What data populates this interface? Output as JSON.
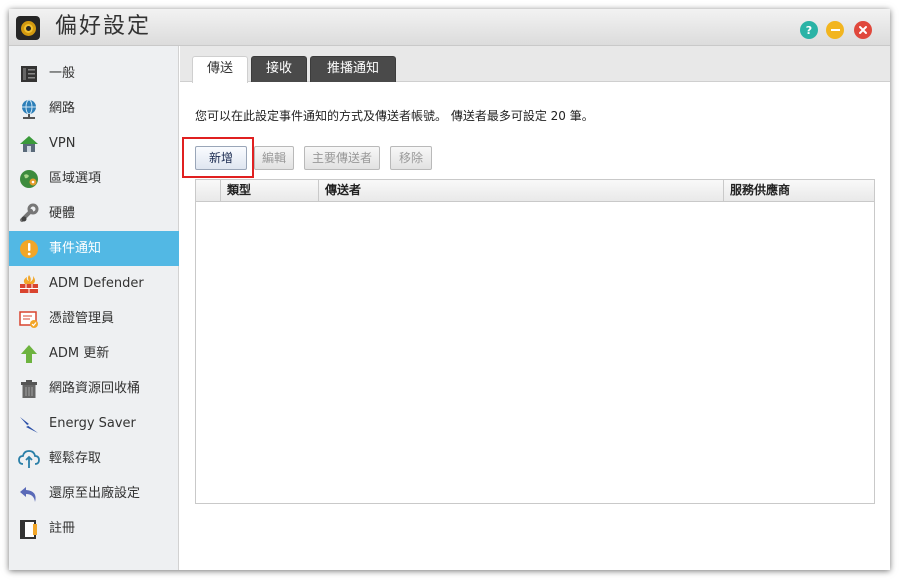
{
  "window": {
    "title": "偏好設定",
    "controls": {
      "help": "?"
    }
  },
  "sidebar": {
    "items": [
      {
        "label": "一般",
        "icon": "server-icon"
      },
      {
        "label": "網路",
        "icon": "globe-icon"
      },
      {
        "label": "VPN",
        "icon": "vpn-house-icon"
      },
      {
        "label": "區域選項",
        "icon": "region-globe-icon"
      },
      {
        "label": "硬體",
        "icon": "hardware-wrench-icon"
      },
      {
        "label": "事件通知",
        "icon": "alert-icon",
        "active": true
      },
      {
        "label": "ADM Defender",
        "icon": "firewall-icon"
      },
      {
        "label": "憑證管理員",
        "icon": "certificate-icon"
      },
      {
        "label": "ADM 更新",
        "icon": "update-arrow-icon"
      },
      {
        "label": "網路資源回收桶",
        "icon": "trash-bin-icon"
      },
      {
        "label": "Energy Saver",
        "icon": "energy-bolt-icon"
      },
      {
        "label": "輕鬆存取",
        "icon": "cloud-upload-icon"
      },
      {
        "label": "還原至出廠設定",
        "icon": "restore-arrow-icon"
      },
      {
        "label": "註冊",
        "icon": "register-icon"
      }
    ]
  },
  "tabs": [
    {
      "label": "傳送",
      "active": true
    },
    {
      "label": "接收"
    },
    {
      "label": "推播通知"
    }
  ],
  "main": {
    "description": "您可以在此設定事件通知的方式及傳送者帳號。 傳送者最多可設定 20 筆。",
    "toolbar": {
      "add": "新增",
      "edit": "編輯",
      "primary_sender": "主要傳送者",
      "remove": "移除"
    },
    "table": {
      "columns": [
        "類型",
        "傳送者",
        "服務供應商"
      ],
      "rows": []
    }
  },
  "colors": {
    "active_sidebar": "#52b8e4",
    "tab_dark": "#4a4a4a",
    "highlight": "#e02020"
  }
}
